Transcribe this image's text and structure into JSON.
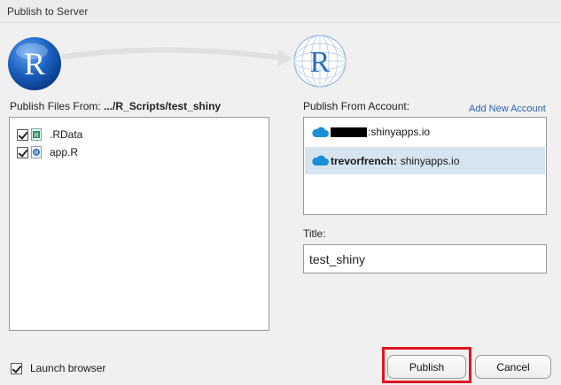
{
  "window": {
    "title": "Publish to Server"
  },
  "files": {
    "label_prefix": "Publish Files From: ",
    "path": ".../R_Scripts/test_shiny",
    "items": [
      {
        "name": ".RData",
        "checked": true,
        "icon": "rdata-file-icon"
      },
      {
        "name": "app.R",
        "checked": true,
        "icon": "r-file-icon"
      }
    ]
  },
  "accounts": {
    "label": "Publish From Account:",
    "add_link": "Add New Account",
    "items": [
      {
        "user": "",
        "server": "shinyapps.io",
        "redacted": true,
        "selected": false,
        "icon": "cloud-icon"
      },
      {
        "user": "trevorfrench:",
        "server": "shinyapps.io",
        "redacted": false,
        "selected": true,
        "icon": "cloud-icon"
      }
    ]
  },
  "title_field": {
    "label": "Title:",
    "value": "test_shiny"
  },
  "launch_browser": {
    "label": "Launch browser",
    "checked": true
  },
  "buttons": {
    "publish": "Publish",
    "cancel": "Cancel"
  },
  "colors": {
    "accent_link": "#2a63b0",
    "selection": "#d6e4f0",
    "highlight": "#e0151f",
    "cloud": "#1a8fd6",
    "r_logo": "#2466b3"
  }
}
